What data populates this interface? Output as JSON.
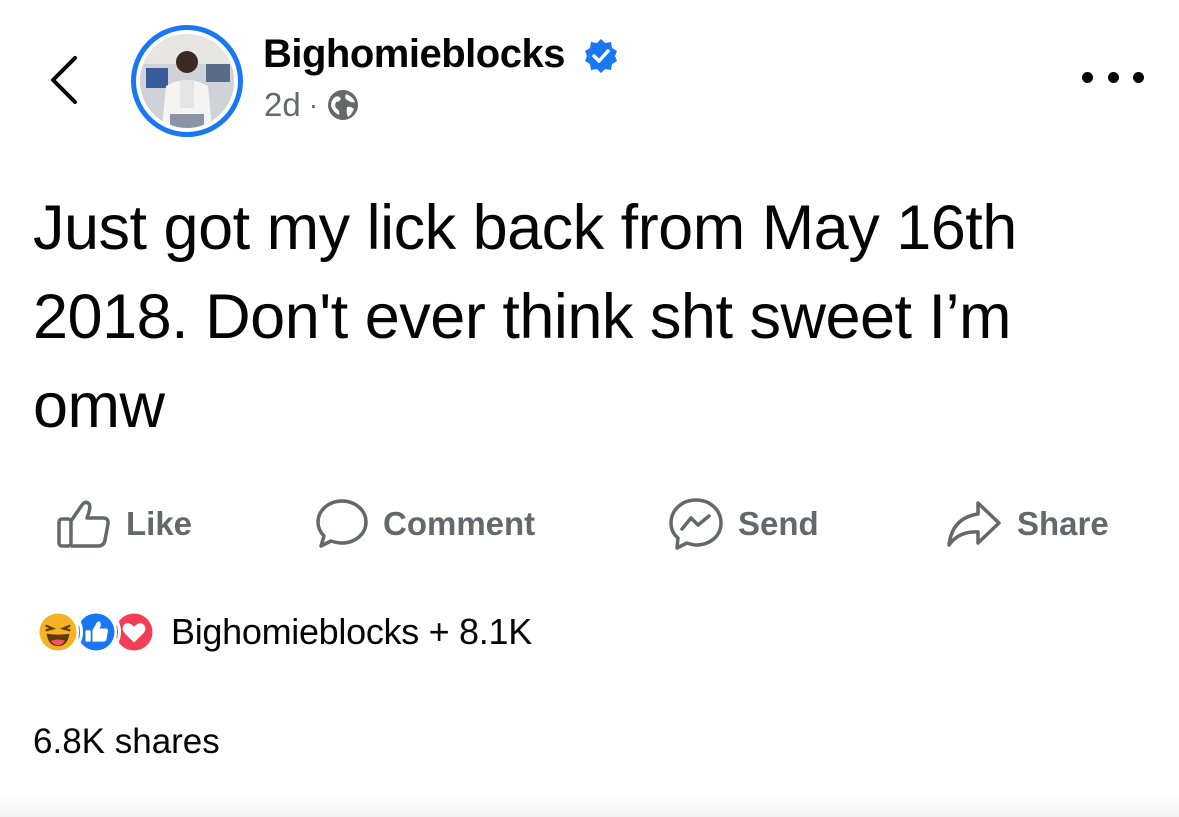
{
  "header": {
    "author_name": "Bighomieblocks",
    "timestamp": "2d",
    "separator": "·",
    "audience_icon": "globe-icon",
    "verified_icon": "verified-badge-icon",
    "back_icon": "chevron-left-icon",
    "more_icon": "more-horizontal-icon"
  },
  "post": {
    "text": "Just got my lick back from May 16th 2018. Don't ever think sht sweet I’m omw"
  },
  "actions": {
    "like_label": "Like",
    "comment_label": "Comment",
    "send_label": "Send",
    "share_label": "Share"
  },
  "reactions": {
    "icons": [
      "haha-icon",
      "like-reaction-icon",
      "love-icon"
    ],
    "summary": "Bighomieblocks + 8.1K"
  },
  "shares": {
    "label": "6.8K shares"
  },
  "colors": {
    "accent": "#1877f2",
    "secondary_text": "#65676b",
    "primary_text": "#050505",
    "love": "#f33e58",
    "haha": "#f7b125"
  }
}
